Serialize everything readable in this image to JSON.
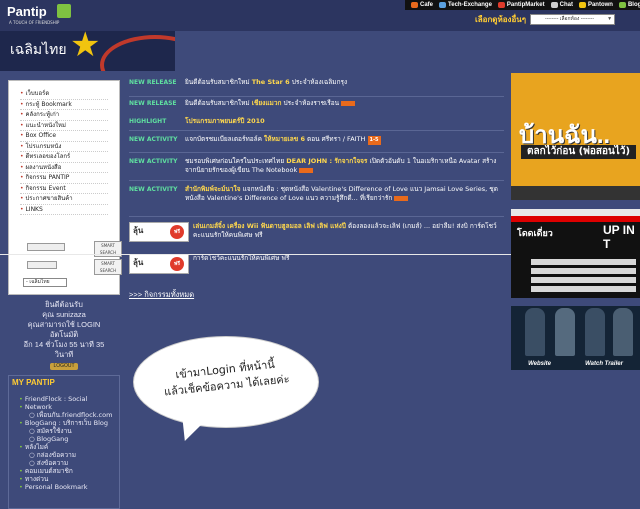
{
  "header": {
    "logo_text": "Pantip",
    "logo_tagline": "A TOUCH OF FRIENDSHIP",
    "top_links": [
      {
        "label": "Cafe",
        "icon": "cafe-icon",
        "color": "#e96a1c"
      },
      {
        "label": "Tech-Exchange",
        "icon": "tech-icon",
        "color": "#5aa0e0"
      },
      {
        "label": "PantipMarket",
        "icon": "market-icon",
        "color": "#e03b2b"
      },
      {
        "label": "Chat",
        "icon": "chat-icon",
        "color": "#cfcfcf"
      },
      {
        "label": "Pantown",
        "icon": "pantown-icon",
        "color": "#f1c40f"
      },
      {
        "label": "BlogGang",
        "icon": "bloggang-icon",
        "color": "#7fc241"
      }
    ],
    "room_label": "เลือกดูห้องอื่นๆ",
    "room_select": "-------- เลือกห้อง --------"
  },
  "banner": {
    "title": "เฉลิมไทย"
  },
  "menu": {
    "items": [
      "เว็บบอร์ด",
      "กระทู้ Bookmark",
      "คลังกระทู้เก่า",
      "แนะนำหนังใหม่",
      "Box Office",
      "โปรแกรมหนัง",
      "ดีทรเลอของโลกร์",
      "ผลงานหนังสือ",
      "กิจกรรม PANTIP",
      "กิจกรรม Event",
      "ประกาศขายสินค้า",
      "LINKS"
    ],
    "smart_label": "SMART SEARCH",
    "lang_select": "- เฉลิมไทย"
  },
  "login": {
    "welcome": "ยินดีต้อนรับ",
    "user": "คุณ sunizaza",
    "status": "คุณสามารถใช้ LOGIN",
    "auto": "อัตโนมัติ",
    "time": "อีก 14 ชั่วโมง 55 นาที 35",
    "sec": "วินาที",
    "logout": "LOGOUT"
  },
  "mypantip": {
    "title": "MY PANTIP",
    "items": [
      {
        "level": 1,
        "text": "FriendFlock : Social"
      },
      {
        "level": 1,
        "text": "Network"
      },
      {
        "level": 2,
        "text": "เพื่อนกัน.friendflock.com"
      },
      {
        "level": 1,
        "text": "BlogGang : บริการเว็บ Blog"
      },
      {
        "level": 2,
        "text": "สมัครใช้งาน"
      },
      {
        "level": 2,
        "text": "BlogGang"
      },
      {
        "level": 1,
        "text": "หลังไมค์"
      },
      {
        "level": 2,
        "text": "กล่องข้อความ"
      },
      {
        "level": 2,
        "text": "ส่งข้อความ"
      },
      {
        "level": 1,
        "text": "คอมเมนต์สมาชิก"
      },
      {
        "level": 1,
        "text": "ทางด่วน"
      },
      {
        "level": 1,
        "text": "Personal Bookmark"
      }
    ]
  },
  "news": [
    {
      "tag": "NEW RELEASE",
      "pre": "ยินดีต้อนรับสมาชิกใหม่",
      "hl": "The Star 6",
      "post": "ประจำห้องเฉลิมกรุง",
      "new": false
    },
    {
      "tag": "NEW RELEASE",
      "pre": "ยินดีต้อนรับสมาชิกใหม่",
      "hl": "เชียงแมวก",
      "post": "ประจำห้องราชเรือน",
      "new": true
    },
    {
      "tag": "HIGHLIGHT",
      "pre": "",
      "hl": "โปรแกรมภาพยนตร์ปี 2010",
      "post": "",
      "new": false
    },
    {
      "tag": "NEW ACTIVITY",
      "pre": "แจกบัตรชมเบียลเตอร์ทอล์ค",
      "hl": "ให้หมายเลข 6",
      "post": "ตอน ศรีทรา / FAITH",
      "score": "1-5",
      "new": false
    },
    {
      "tag": "NEW ACTIVITY",
      "pre": "ชมรอบพิเศษก่อนใครในประเทศไทย",
      "hl": "DEAR JOHN : รักจากใจจร",
      "post": "เปิดตัวอันดับ 1 ในอเมริกาเหนือ Avatar สร้างจากนิยายรักของผู้เขียน The Notebook",
      "new": true
    },
    {
      "tag": "NEW ACTIVITY",
      "pre": "",
      "hl": "สำนักพิมพ์จะม์นาใจ",
      "post": "แจกหนังสือ : ชุดหนังสือ Valentine's Difference of Love แนว Jamsai Love Series, ชุดหนังสือ Valentine's Difference of Love แนว ความรู้สึกดี... ที่เรียกว่ารัก",
      "new": true
    },
    {
      "tag": "",
      "pre": "",
      "hl": "เล่นเกมส์จิ๋ง เครื่อง Wii ฟันดาบฮูลมอล เลิฟ เลิฟ แห่งปี",
      "post": "ต้องลองแล้วจะเลิฟ (เกมส์) ... อย่าลืม! ส่งบิ การ์ดโชว์คะแนนรักให้คนพิเศษ ฟรี",
      "new": false
    },
    {
      "tag": "",
      "pre": "",
      "hl": "",
      "post": "การ์ดโชว์คะแนนรักให้คนพิเศษ ฟรี",
      "new": false
    }
  ],
  "promo": {
    "big": "ลุ้น",
    "small": "รับ Wii",
    "free": "ฟรี"
  },
  "all_activities": ">>> กิจกรรมทั้งหมด",
  "ads": {
    "ad1_title": "บ้านฉัน..",
    "ad1_sub": "ตลกไว้ก่อน (พ่อสอนไว้)",
    "ad2_title": "UP IN T",
    "ad2_thai": "โดดเดี่ยว",
    "ad3_buttons": [
      "Website",
      "Watch Trailer"
    ]
  },
  "bubble": {
    "line1": "เข้ามาLogin ที่หน้านี้",
    "line2": "แล้วเช็คข้อความ ได้เลยค่ะ"
  }
}
